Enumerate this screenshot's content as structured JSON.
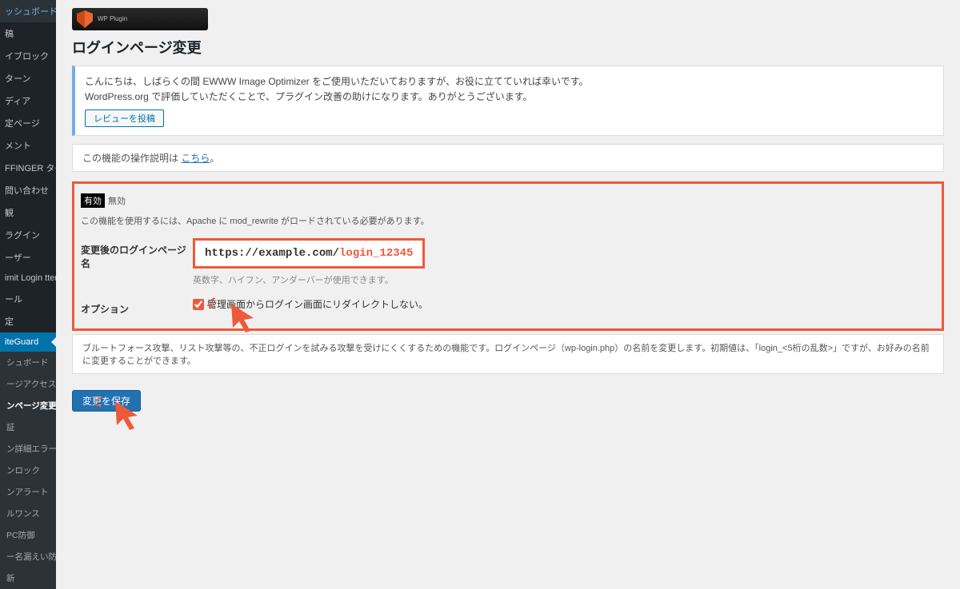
{
  "sidebar": {
    "items": [
      "ッシュボード",
      "稿",
      "イブロック",
      "ターン",
      "ディア",
      "定ページ",
      "メント",
      "FFINGER タグ",
      "問い合わせ",
      "観",
      "ラグイン",
      "ーザー",
      "imit Login ttempts",
      "ール",
      "定"
    ],
    "activeItem": "iteGuard",
    "submenu": [
      "シュボード",
      "ージアクセス制限",
      "ンページ変更",
      "証",
      "ン詳細エラーメッ の無効化",
      "ンロック",
      "ンアラート",
      "ルワンス",
      "PC防御",
      "ー名漏えい防御",
      "新"
    ]
  },
  "logo": {
    "sub": "WP Plugin"
  },
  "page": {
    "title": "ログインページ変更"
  },
  "notice": {
    "line1": "こんにちは、しばらくの間 EWWW Image Optimizer をご使用いただいておりますが、お役に立てていれば幸いです。",
    "line2": "WordPress.org で評価していただくことで、プラグイン改善の助けになります。ありがとうございます。",
    "button": "レビューを投稿"
  },
  "desc": {
    "prefix": "この機能の操作説明は ",
    "link": "こちら",
    "suffix": "。"
  },
  "form": {
    "toggle_on": "有効",
    "toggle_off": "無効",
    "apache_hint": "この機能を使用するには、Apache に mod_rewrite がロードされている必要があります。",
    "label_name": "変更後のログインページ名",
    "url_base": "https://example.com/",
    "url_path": "login_12345",
    "name_hint": "英数字、ハイフン、アンダーバーが使用できます。",
    "label_option": "オプション",
    "option_text": "管理画面からログイン画面にリダイレクトしない。"
  },
  "footnote": "ブルートフォース攻撃、リスト攻撃等の、不正ログインを試みる攻撃を受けにくくするための機能です。ログインページ（wp-login.php）の名前を変更します。初期値は、「login_<5桁の乱数>」ですが、お好みの名前に変更することができます。",
  "save_button": "変更を保存"
}
